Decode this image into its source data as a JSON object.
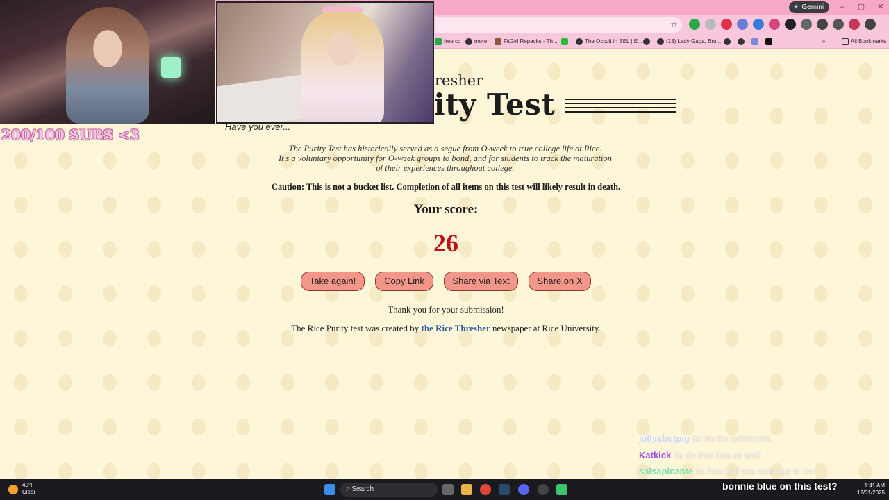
{
  "browser": {
    "gemini_label": "Gemini",
    "bookmarks": [
      "free cc",
      "more",
      "FitGirl Repacks - Th...",
      "The Occult in SEL | E...",
      "(13) Lady Gaga, Bru..."
    ],
    "all_bookmarks_label": "All Bookmarks",
    "more_bookmarks": "»"
  },
  "page": {
    "header_word": "resher",
    "title": "rity Test",
    "subheading": "Have you ever...",
    "intro_lines": [
      "The Purity Test has historically served as a segue from O-week to true college life at Rice.",
      "It's a voluntary opportunity for O-week groups to bond, and for students to track the maturation",
      "of their experiences throughout college."
    ],
    "caution": "Caution: This is not a bucket list. Completion of all items on this test will likely result in death.",
    "score_label": "Your score:",
    "score": "26",
    "buttons": {
      "take_again": "Take again!",
      "copy_link": "Copy Link",
      "share_text": "Share via Text",
      "share_x": "Share on X"
    },
    "thanks": "Thank you for your submission!",
    "credit_prefix": "The Rice Purity test was created by ",
    "credit_link": "the Rice Thresher",
    "credit_suffix": " newspaper at Rice University."
  },
  "stream": {
    "subs_goal": "200/100 SUBS <3",
    "chat": [
      {
        "user": "jollysbutpig",
        "color": "#c9d8f0",
        "message": "its do the bdsm test"
      },
      {
        "user": "Katkick",
        "color": "#a04adf",
        "message": "its do that test as well"
      },
      {
        "user": "salsapicante",
        "color": "#7fdca0",
        "message": "its how did you manage to tie"
      }
    ],
    "popup": "bonnie blue on this test?"
  },
  "taskbar": {
    "temp": "40°F",
    "condition": "Clear",
    "search_placeholder": "Search",
    "time": "1:41 AM",
    "date": "12/31/2025"
  }
}
